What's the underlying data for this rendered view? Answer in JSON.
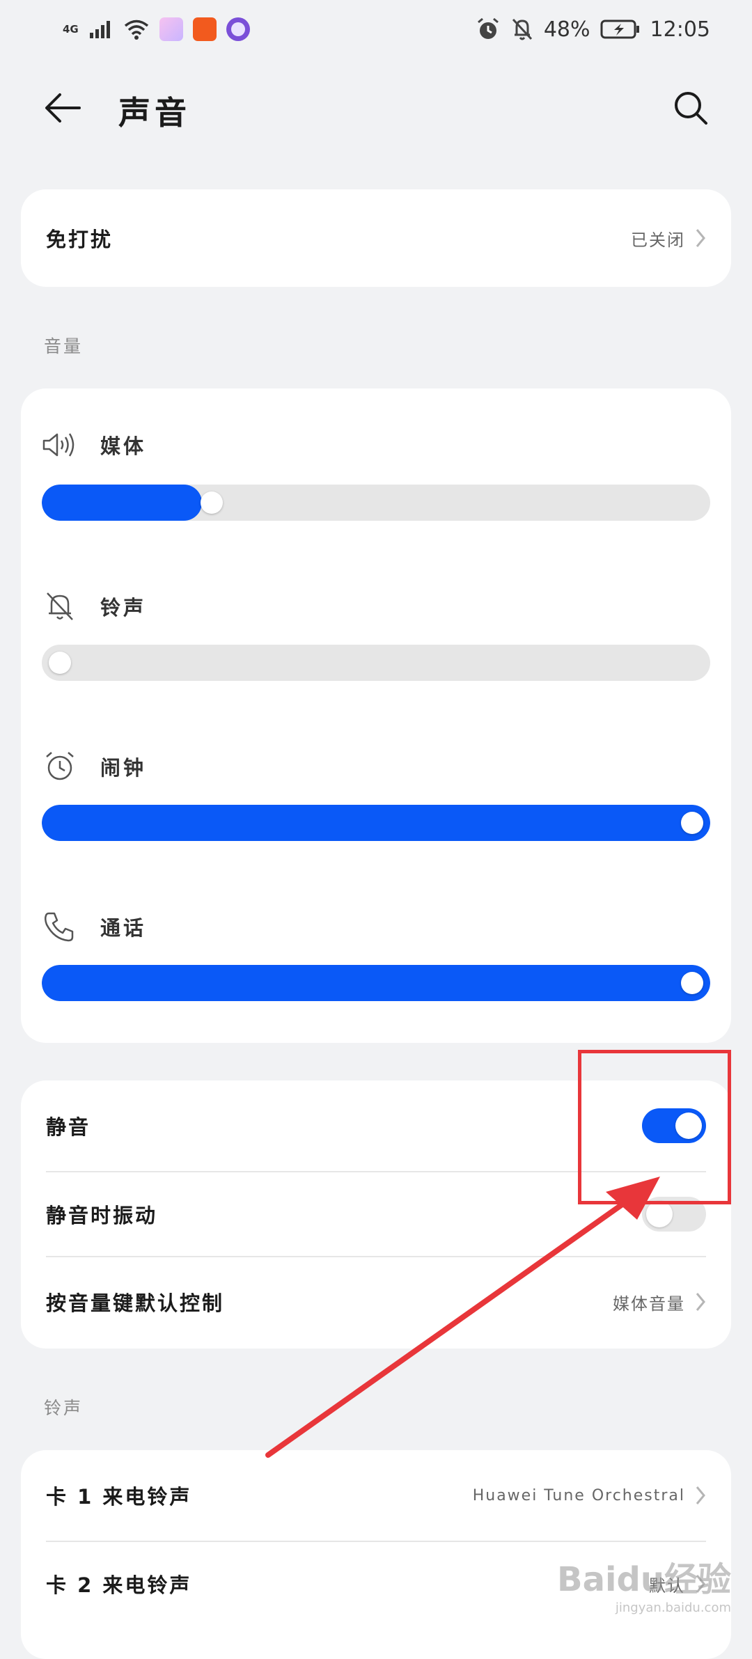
{
  "status": {
    "network": "4G",
    "battery": "48%",
    "time": "12:05"
  },
  "header": {
    "title": "声音"
  },
  "dnd": {
    "label": "免打扰",
    "value": "已关闭"
  },
  "volume": {
    "section_label": "音量",
    "items": [
      {
        "label": "媒体",
        "icon": "speaker-icon",
        "level": 0.24
      },
      {
        "label": "铃声",
        "icon": "bell-off-icon",
        "level": 0.0
      },
      {
        "label": "闹钟",
        "icon": "alarm-clock-icon",
        "level": 1.0
      },
      {
        "label": "通话",
        "icon": "phone-icon",
        "level": 1.0
      }
    ]
  },
  "mute": {
    "mute_label": "静音",
    "mute_on": true,
    "vibrate_label": "静音时振动",
    "vibrate_on": false,
    "key_label": "按音量键默认控制",
    "key_value": "媒体音量"
  },
  "ringtone": {
    "section_label": "铃声",
    "card1_label": "卡 1 来电铃声",
    "card1_value": "Huawei Tune Orchestral",
    "card2_label": "卡 2 来电铃声",
    "card2_value": "默认"
  },
  "watermark": {
    "logo": "Baidu经验",
    "url": "jingyan.baidu.com"
  },
  "colors": {
    "accent": "#0a59f7",
    "annotation": "#e8363a",
    "background": "#f1f2f4"
  }
}
